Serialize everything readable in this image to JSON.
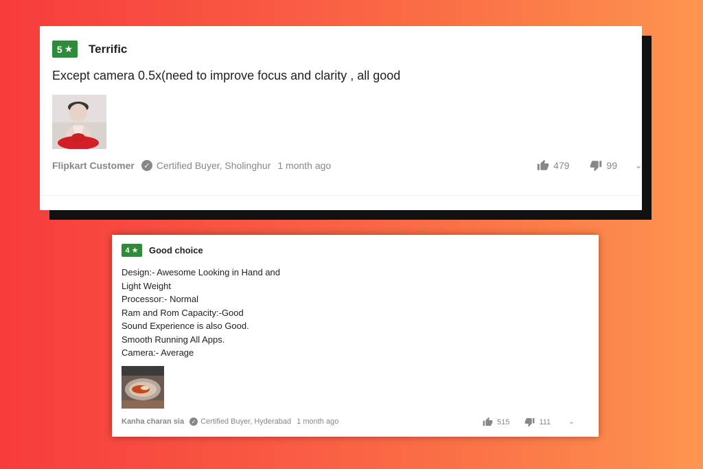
{
  "reviews": [
    {
      "rating": "5",
      "title": "Terrific",
      "text": "Except camera 0.5x(need to improve focus and clarity , all good",
      "author": "Flipkart Customer",
      "certified": "Certified Buyer, Sholinghur",
      "date": "1 month ago",
      "likes": "479",
      "dislikes": "99",
      "image": "doll-figurine-photo"
    },
    {
      "rating": "4",
      "title": "Good choice",
      "lines": [
        "Design:- Awesome Looking in Hand and",
        "Light Weight",
        "Processor:- Normal",
        "Ram and Rom Capacity:-Good",
        "Sound Experience is also Good.",
        "Smooth Running All Apps.",
        "Camera:- Average"
      ],
      "author": "Kanha charan sia",
      "certified": "Certified Buyer, Hyderabad",
      "date": "1 month ago",
      "likes": "515",
      "dislikes": "111",
      "image": "food-plate-photo"
    }
  ],
  "icons": {
    "star": "★",
    "check": "✓",
    "chevron": "⌄"
  },
  "colors": {
    "badge_green": "#2e8b3a",
    "meta_gray": "#878787",
    "bg_red": "#f73c3c",
    "bg_orange": "#fd9550"
  }
}
